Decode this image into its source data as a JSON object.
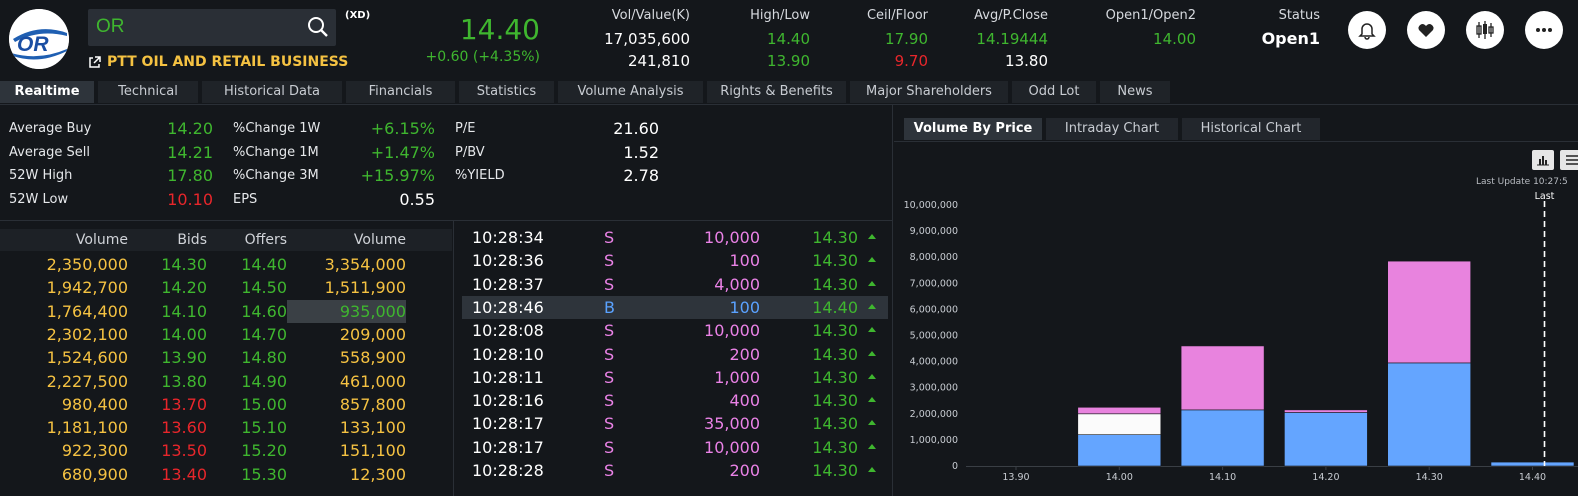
{
  "header": {
    "symbol": "OR",
    "flag": "(XD)",
    "company": "PTT OIL AND RETAIL BUSINESS",
    "logo_text": "OR",
    "price": "14.40",
    "change": "+0.60 (+4.35%)",
    "vol_value": {
      "label": "Vol/Value(K)",
      "v1": "17,035,600",
      "v2": "241,810"
    },
    "high_low": {
      "label": "High/Low",
      "v1": "14.40",
      "v2": "13.90"
    },
    "ceil_floor": {
      "label": "Ceil/Floor",
      "v1": "17.90",
      "v2": "9.70"
    },
    "avg_pclose": {
      "label": "Avg/P.Close",
      "v1": "14.19444",
      "v2": "13.80"
    },
    "open": {
      "label": "Open1/Open2",
      "v1": "14.00",
      "v2": ""
    },
    "status": {
      "label": "Status",
      "v1": "Open1"
    }
  },
  "tabs": [
    "Realtime",
    "Technical",
    "Historical Data",
    "Financials",
    "Statistics",
    "Volume Analysis",
    "Rights & Benefits",
    "Major Shareholders",
    "Odd Lot",
    "News"
  ],
  "stats": {
    "col1": [
      {
        "label": "Average Buy",
        "value": "14.20",
        "color": "#3fb62f"
      },
      {
        "label": "Average Sell",
        "value": "14.21",
        "color": "#3fb62f"
      },
      {
        "label": "52W High",
        "value": "17.80",
        "color": "#3fb62f"
      },
      {
        "label": "52W Low",
        "value": "10.10",
        "color": "#e8262b"
      }
    ],
    "col2": [
      {
        "label": "%Change 1W",
        "value": "+6.15%",
        "color": "#3fb62f"
      },
      {
        "label": "%Change 1M",
        "value": "+1.47%",
        "color": "#3fb62f"
      },
      {
        "label": "%Change 3M",
        "value": "+15.97%",
        "color": "#3fb62f"
      },
      {
        "label": "EPS",
        "value": "0.55",
        "color": "#ffffff"
      }
    ],
    "col3": [
      {
        "label": "P/E",
        "value": "21.60",
        "color": "#ffffff"
      },
      {
        "label": "P/BV",
        "value": "1.52",
        "color": "#ffffff"
      },
      {
        "label": "%YIELD",
        "value": "2.78",
        "color": "#ffffff"
      }
    ]
  },
  "bidoffer": {
    "headers": [
      "Volume",
      "Bids",
      "Offers",
      "Volume"
    ],
    "rows": [
      {
        "bvol": "2,350,000",
        "bid": "14.30",
        "bidc": "#3fb62f",
        "offer": "14.40",
        "offc": "#3fb62f",
        "ovol": "3,354,000"
      },
      {
        "bvol": "1,942,700",
        "bid": "14.20",
        "bidc": "#3fb62f",
        "offer": "14.50",
        "offc": "#3fb62f",
        "ovol": "1,511,900"
      },
      {
        "bvol": "1,764,400",
        "bid": "14.10",
        "bidc": "#3fb62f",
        "offer": "14.60",
        "offc": "#3fb62f",
        "ovol": "935,000",
        "hl": true
      },
      {
        "bvol": "2,302,100",
        "bid": "14.00",
        "bidc": "#3fb62f",
        "offer": "14.70",
        "offc": "#3fb62f",
        "ovol": "209,000"
      },
      {
        "bvol": "1,524,600",
        "bid": "13.90",
        "bidc": "#3fb62f",
        "offer": "14.80",
        "offc": "#3fb62f",
        "ovol": "558,900"
      },
      {
        "bvol": "2,227,500",
        "bid": "13.80",
        "bidc": "#3fb62f",
        "offer": "14.90",
        "offc": "#3fb62f",
        "ovol": "461,000"
      },
      {
        "bvol": "980,400",
        "bid": "13.70",
        "bidc": "#e8262b",
        "offer": "15.00",
        "offc": "#3fb62f",
        "ovol": "857,800"
      },
      {
        "bvol": "1,181,100",
        "bid": "13.60",
        "bidc": "#e8262b",
        "offer": "15.10",
        "offc": "#3fb62f",
        "ovol": "133,100"
      },
      {
        "bvol": "922,300",
        "bid": "13.50",
        "bidc": "#e8262b",
        "offer": "15.20",
        "offc": "#3fb62f",
        "ovol": "151,100"
      },
      {
        "bvol": "680,900",
        "bid": "13.40",
        "bidc": "#e8262b",
        "offer": "15.30",
        "offc": "#3fb62f",
        "ovol": "12,300"
      }
    ]
  },
  "ticker": [
    {
      "time": "10:28:34",
      "side": "S",
      "vol": "10,000",
      "price": "14.30"
    },
    {
      "time": "10:28:36",
      "side": "S",
      "vol": "100",
      "price": "14.30"
    },
    {
      "time": "10:28:37",
      "side": "S",
      "vol": "4,000",
      "price": "14.30"
    },
    {
      "time": "10:28:46",
      "side": "B",
      "vol": "100",
      "price": "14.40",
      "hl": true
    },
    {
      "time": "10:28:08",
      "side": "S",
      "vol": "10,000",
      "price": "14.30"
    },
    {
      "time": "10:28:10",
      "side": "S",
      "vol": "200",
      "price": "14.30"
    },
    {
      "time": "10:28:11",
      "side": "S",
      "vol": "1,000",
      "price": "14.30"
    },
    {
      "time": "10:28:16",
      "side": "S",
      "vol": "400",
      "price": "14.30"
    },
    {
      "time": "10:28:17",
      "side": "S",
      "vol": "35,000",
      "price": "14.30"
    },
    {
      "time": "10:28:17",
      "side": "S",
      "vol": "10,000",
      "price": "14.30"
    },
    {
      "time": "10:28:28",
      "side": "S",
      "vol": "200",
      "price": "14.30"
    }
  ],
  "right_tabs": [
    "Volume By Price",
    "Intraday Chart",
    "Historical Chart"
  ],
  "last_update": "Last Update 10:27:5",
  "last_label": "Last",
  "chart_data": {
    "type": "bar",
    "stacked": true,
    "categories": [
      "13.90",
      "14.00",
      "14.10",
      "14.20",
      "14.30",
      "14.40"
    ],
    "series": [
      {
        "color": "#64a5ff",
        "values": [
          0,
          1200000,
          2150000,
          2050000,
          3950000,
          150000
        ]
      },
      {
        "color": "#fbfbfb",
        "values": [
          0,
          800000,
          0,
          0,
          0,
          0
        ]
      },
      {
        "color": "#e883de",
        "values": [
          0,
          250000,
          2450000,
          100000,
          3900000,
          0
        ]
      }
    ],
    "ylim": [
      0,
      10000000
    ],
    "yticks": [
      "0",
      "1,000,000",
      "2,000,000",
      "3,000,000",
      "4,000,000",
      "5,000,000",
      "6,000,000",
      "7,000,000",
      "8,000,000",
      "9,000,000",
      "10,000,000"
    ],
    "last_price": "14.40",
    "grid": false
  }
}
